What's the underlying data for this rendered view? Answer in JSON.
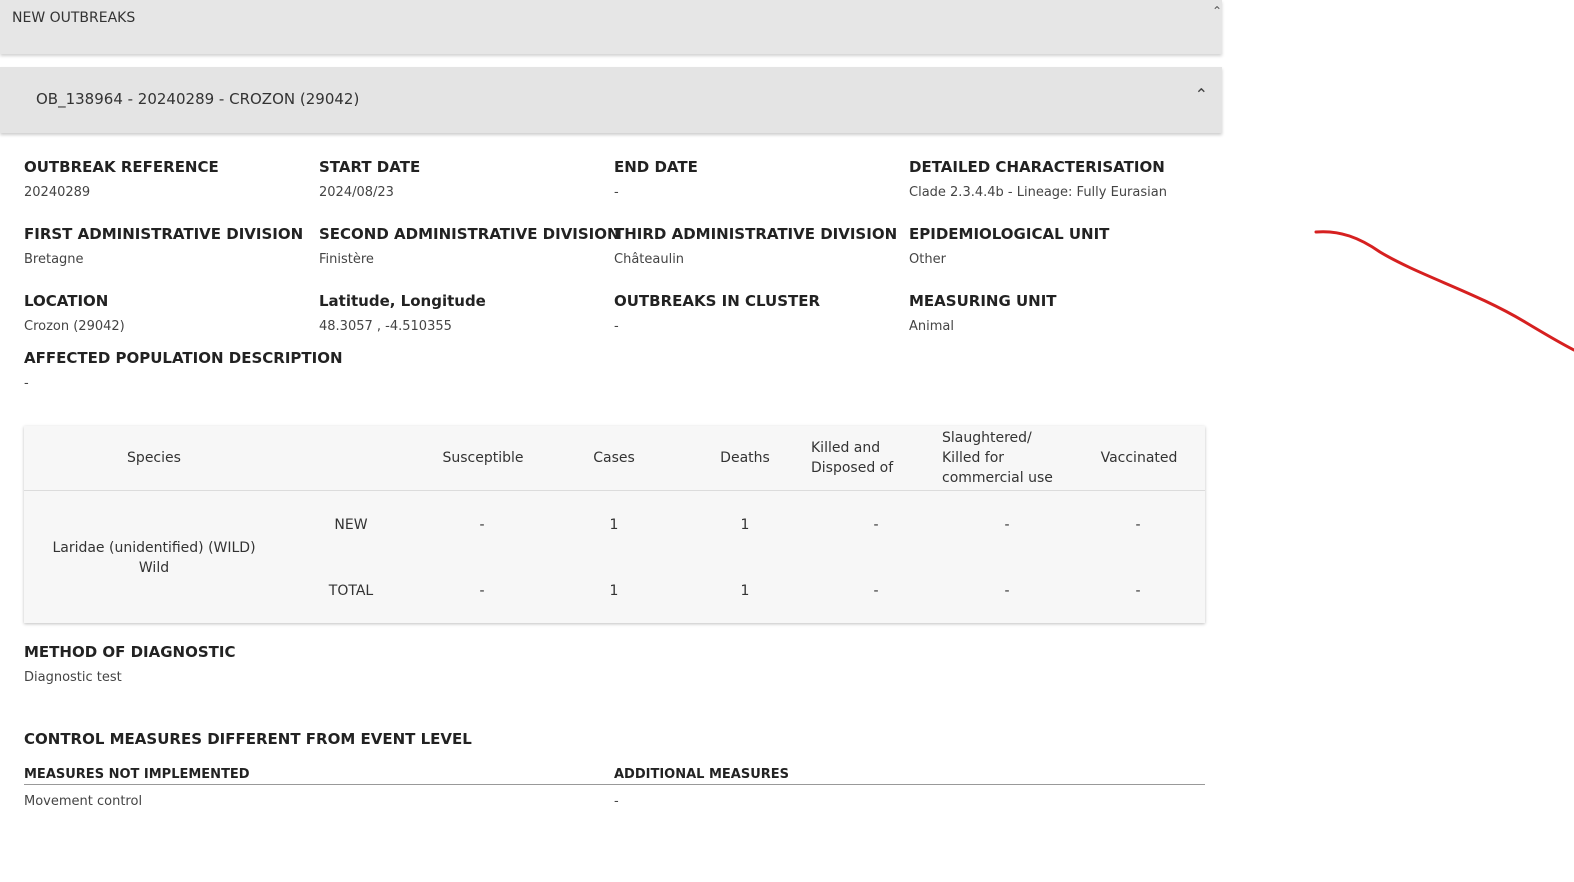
{
  "section": {
    "title": "NEW OUTBREAKS"
  },
  "outbreak": {
    "title": "OB_138964 - 20240289 - CROZON (29042)",
    "fields": {
      "outbreak_reference": {
        "label": "OUTBREAK REFERENCE",
        "value": "20240289"
      },
      "start_date": {
        "label": "START DATE",
        "value": "2024/08/23"
      },
      "end_date": {
        "label": "END DATE",
        "value": "-"
      },
      "detailed_characterisation": {
        "label": "DETAILED CHARACTERISATION",
        "value": "Clade 2.3.4.4b - Lineage: Fully Eurasian"
      },
      "first_admin": {
        "label": "FIRST ADMINISTRATIVE DIVISION",
        "value": "Bretagne"
      },
      "second_admin": {
        "label": "SECOND ADMINISTRATIVE DIVISION",
        "value": "Finistère"
      },
      "third_admin": {
        "label": "THIRD ADMINISTRATIVE DIVISION",
        "value": "Châteaulin"
      },
      "epi_unit": {
        "label": "EPIDEMIOLOGICAL UNIT",
        "value": "Other"
      },
      "location": {
        "label": "LOCATION",
        "value": "Crozon (29042)"
      },
      "lat_long": {
        "label": "Latitude, Longitude",
        "value": "48.3057 , -4.510355"
      },
      "outbreaks_in_cluster": {
        "label": "OUTBREAKS IN CLUSTER",
        "value": "-"
      },
      "measuring_unit": {
        "label": "MEASURING UNIT",
        "value": "Animal"
      },
      "affected_population": {
        "label": "AFFECTED POPULATION DESCRIPTION",
        "value": "-"
      }
    },
    "table": {
      "headers": {
        "species": "Species",
        "susceptible": "Susceptible",
        "cases": "Cases",
        "deaths": "Deaths",
        "killed_disposed": "Killed and Disposed of",
        "slaughtered": "Slaughtered/ Killed for commercial use",
        "vaccinated": "Vaccinated"
      },
      "species_name": "Laridae (unidentified) (WILD)",
      "species_type": "Wild",
      "rows": [
        {
          "label": "NEW",
          "susceptible": "-",
          "cases": "1",
          "deaths": "1",
          "killed_disposed": "-",
          "slaughtered": "-",
          "vaccinated": "-"
        },
        {
          "label": "TOTAL",
          "susceptible": "-",
          "cases": "1",
          "deaths": "1",
          "killed_disposed": "-",
          "slaughtered": "-",
          "vaccinated": "-"
        }
      ]
    },
    "method": {
      "label": "METHOD OF DIAGNOSTIC",
      "value": "Diagnostic test"
    },
    "control": {
      "title": "CONTROL MEASURES DIFFERENT FROM EVENT LEVEL",
      "not_implemented_label": "MEASURES NOT IMPLEMENTED",
      "not_implemented_value": "Movement control",
      "additional_label": "ADDITIONAL MEASURES",
      "additional_value": "-"
    }
  },
  "colors": {
    "annotation": "#d62020",
    "bar_bg": "#e4e4e4",
    "table_bg": "#f7f7f7"
  },
  "icons": {
    "collapse": "chevron-up-icon"
  }
}
